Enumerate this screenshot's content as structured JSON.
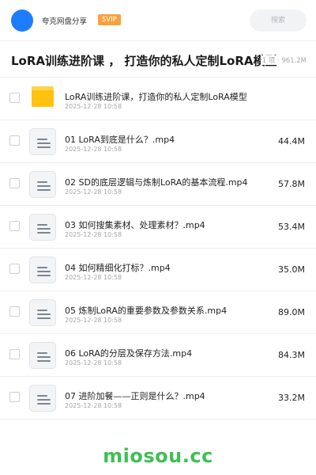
{
  "header": {
    "app_name": "夸克网盘分享",
    "badge": "SVIP",
    "search_placeholder": "搜索"
  },
  "share": {
    "title": "LoRA训练进阶课 ， 打造你的私人定制LoRA模型",
    "summary": "1 项 · 961.2M"
  },
  "files": [
    {
      "type": "folder",
      "name": "LoRA训练进阶课，打造你的私人定制LoRA模型",
      "date": "2025-12-28 10:58",
      "size": ""
    },
    {
      "type": "file",
      "name": "01 LoRA到底是什么？.mp4",
      "date": "2025-12-28 10:58",
      "size": "44.4M"
    },
    {
      "type": "file",
      "name": "02 SD的底层逻辑与炼制LoRA的基本流程.mp4",
      "date": "2025-12-28 10:58",
      "size": "57.8M"
    },
    {
      "type": "file",
      "name": "03 如何搜集素材、处理素材？.mp4",
      "date": "2025-12-28 10:58",
      "size": "53.4M"
    },
    {
      "type": "file",
      "name": "04 如何精细化打标？.mp4",
      "date": "2025-12-28 10:58",
      "size": "35.0M"
    },
    {
      "type": "file",
      "name": "05 炼制LoRA的重要参数及参数关系.mp4",
      "date": "2025-12-28 10:58",
      "size": "89.0M"
    },
    {
      "type": "file",
      "name": "06 LoRA的分层及保存方法.mp4",
      "date": "2025-12-28 10:58",
      "size": "84.3M"
    },
    {
      "type": "file",
      "name": "07 进阶加餐——正则是什么？.mp4",
      "date": "2025-12-28 10:58",
      "size": "33.2M"
    }
  ],
  "watermark": "miosou.cc",
  "colors": {
    "avatar": "#1e7cff",
    "svip_badge": "#f7a23b",
    "folder": "#ffc20e",
    "watermark": "#3fbf55"
  }
}
